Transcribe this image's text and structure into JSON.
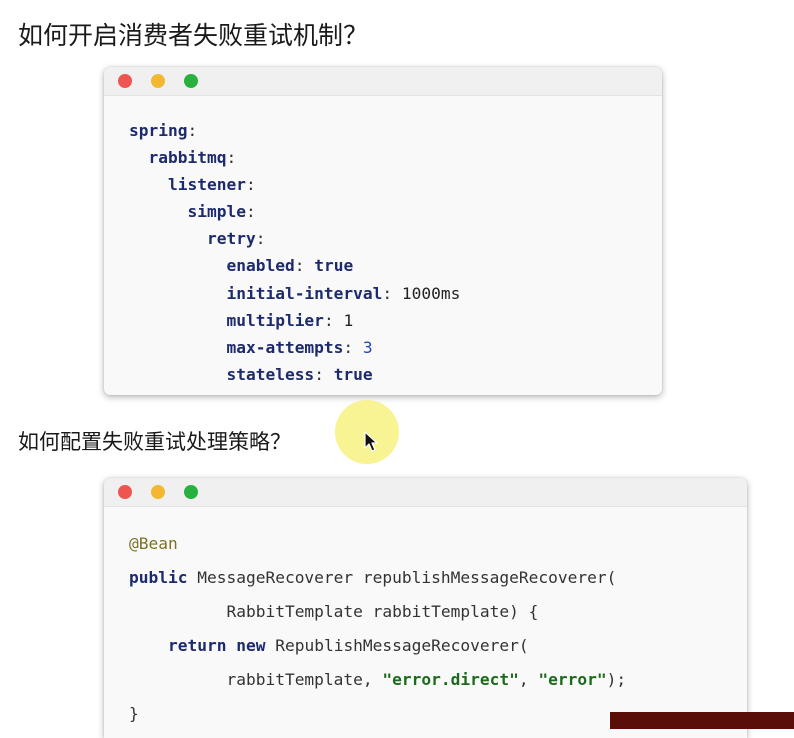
{
  "heading1": "如何开启消费者失败重试机制？",
  "heading2": "如何配置失败重试处理策略？",
  "window_controls": [
    "close-dot",
    "minimize-dot",
    "zoom-dot"
  ],
  "colors": {
    "key": "#1d2a6e",
    "number": "#2a44b8",
    "annotation": "#7c7126",
    "string": "#1c6a1c",
    "dot_red": "#ee5550",
    "dot_yellow": "#f3b731",
    "dot_green": "#29b140"
  },
  "yaml": {
    "l1_key": "spring",
    "l2_key": "rabbitmq",
    "l3_key": "listener",
    "l4_key": "simple",
    "l5_key": "retry",
    "enabled_key": "enabled",
    "enabled_val": "true",
    "interval_key": "initial-interval",
    "interval_val": "1000ms",
    "multiplier_key": "multiplier",
    "multiplier_val": "1",
    "attempts_key": "max-attempts",
    "attempts_val": "3",
    "stateless_key": "stateless",
    "stateless_val": "true"
  },
  "java": {
    "annotation": "@Bean",
    "kw_public": "public",
    "return_type": "MessageRecoverer",
    "method_sig": "republishMessageRecoverer(",
    "param": "RabbitTemplate rabbitTemplate) {",
    "kw_return": "return",
    "kw_new": "new",
    "ctor_call": "RepublishMessageRecoverer(",
    "arg1": "rabbitTemplate,",
    "arg2": "\"error.direct\"",
    "sep": ",",
    "arg3": "\"error\"",
    "end": ");",
    "close_brace": "}"
  },
  "icons": {
    "cursor": "pointer-cursor-icon"
  }
}
